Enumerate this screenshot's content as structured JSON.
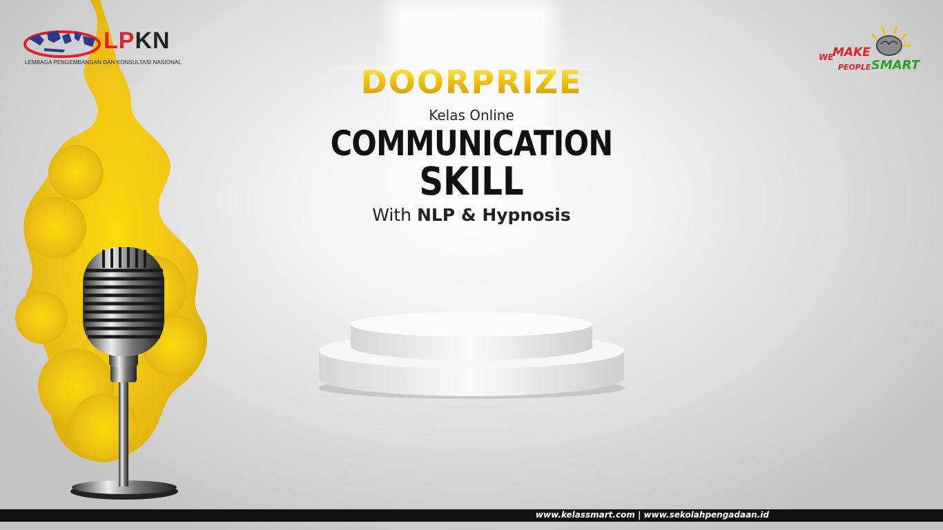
{
  "logo": {
    "name_part1": "LP",
    "name_part2": "KN",
    "subtitle": "LEMBAGA PENGEMBANGAN DAN KONSULTASI NASIONAL"
  },
  "slogan": {
    "we": "WE",
    "make": "MAKE",
    "people": "PEOPLE",
    "smart": "SMART"
  },
  "headline": {
    "label": "DOORPRIZE",
    "kicker": "Kelas Online",
    "title_line1": "COMMUNICATION",
    "title_line2": "SKILL",
    "with": "With",
    "subtitle_bold": "NLP & Hypnosis"
  },
  "footer": {
    "websites": "www.kelassmart.com | www.sekolahpengadaan.id"
  },
  "colors": {
    "gold": "#f5c400",
    "smoke": "#f2cc10",
    "brand_red": "#e0202a",
    "brand_green": "#2ea02e",
    "bar": "#111111"
  }
}
